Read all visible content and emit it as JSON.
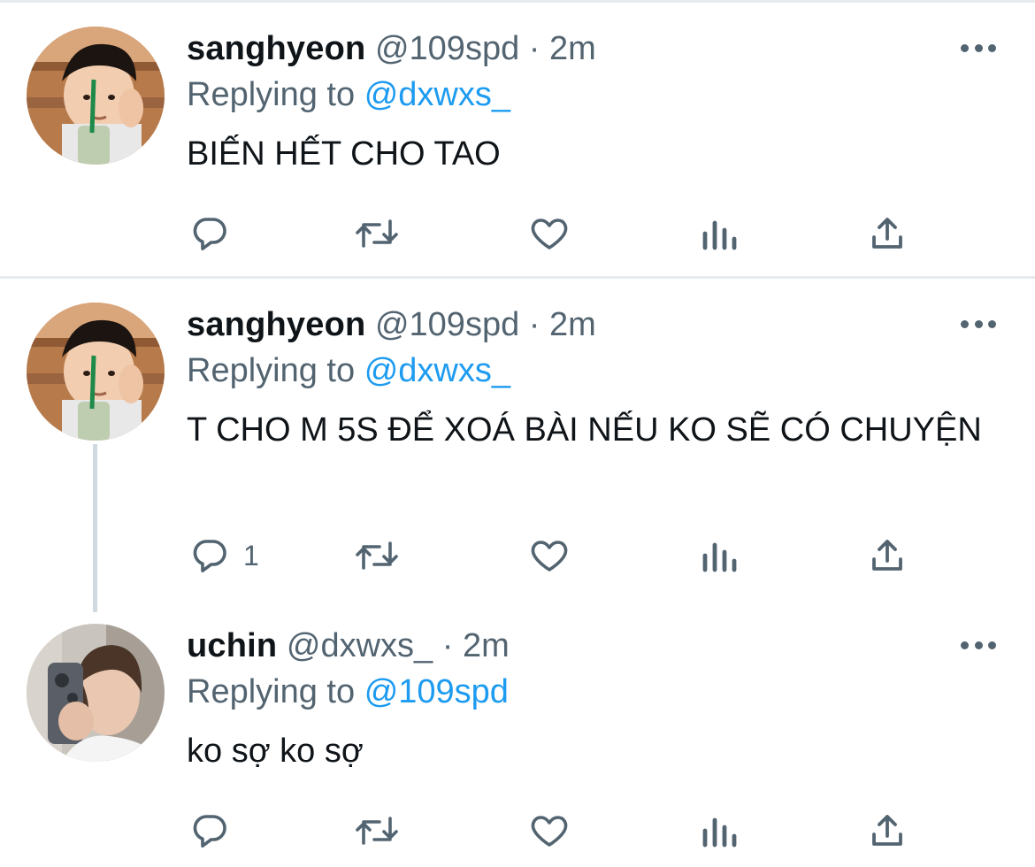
{
  "tweets": [
    {
      "name": "sanghyeon",
      "handle": "@109spd",
      "separator": "·",
      "time": "2m",
      "replying_prefix": "Replying to",
      "replying_to": "@dxwxs_",
      "text": "BIẾN HẾT CHO TAO",
      "reply_count": ""
    },
    {
      "name": "sanghyeon",
      "handle": "@109spd",
      "separator": "·",
      "time": "2m",
      "replying_prefix": "Replying to",
      "replying_to": "@dxwxs_",
      "text": "T CHO M 5S ĐỂ XOÁ BÀI NẾU KO SẼ CÓ CHUYỆN",
      "reply_count": "1"
    },
    {
      "name": "uchin",
      "handle": "@dxwxs_",
      "separator": "·",
      "time": "2m",
      "replying_prefix": "Replying to",
      "replying_to": "@109spd",
      "text": "ko sợ ko sợ",
      "reply_count": ""
    }
  ],
  "icons": {
    "reply": "reply-icon",
    "retweet": "retweet-icon",
    "like": "heart-icon",
    "views": "views-icon",
    "share": "share-icon",
    "more": "more-icon"
  },
  "colors": {
    "text": "#0f1419",
    "secondary": "#536471",
    "link": "#1d9bf0",
    "divider": "#e6ebef",
    "thread_line": "#cfd9de"
  }
}
